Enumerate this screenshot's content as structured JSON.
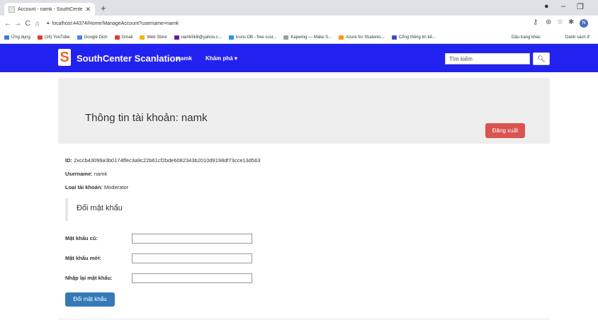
{
  "browser": {
    "tab_title": "Account - namk - SouthCenter S",
    "new_tab": "+",
    "address": "localhost:44374/Home/ManageAccount?username=namk",
    "profile_initial": "N",
    "bookmarks": [
      {
        "label": "Ứng dụng",
        "color": "#3c7ae5"
      },
      {
        "label": "(18) YouTube",
        "color": "#e53935"
      },
      {
        "label": "Google Dịch",
        "color": "#4285f4"
      },
      {
        "label": "Gmail",
        "color": "#e53935"
      },
      {
        "label": "Web Store",
        "color": "#f4b400"
      },
      {
        "label": "namk5kill@yahoo.c...",
        "color": "#6a1b9a"
      },
      {
        "label": "Icons DB - free cust...",
        "color": "#2196f3"
      },
      {
        "label": "Kapwing — Make S...",
        "color": "#9e9e9e"
      },
      {
        "label": "Azure for Students...",
        "color": "#ff9800"
      },
      {
        "label": "Cổng thông tin tiế...",
        "color": "#3f51b5"
      }
    ],
    "bookmarks_other": "Dấu trang khác",
    "reading_list": "Danh sách đ"
  },
  "site": {
    "brand": "SouthCenter Scanlation",
    "logo_letter": "S",
    "nav_user": "namk",
    "nav_explore": "Khám phá ▾",
    "search_placeholder": "Tìm kiếm"
  },
  "account": {
    "heading": "Thông tin tài khoản: namk",
    "logout_label": "Đăng xuất",
    "id_label": "ID:",
    "id_value": "2xccb43099a3b0174ffec3a9c22b61cf2bde6082343b2010d9198df73cce13d563",
    "username_label": "Username:",
    "username_value": "namk",
    "type_label": "Loại tài khoản:",
    "type_value": "Moderator"
  },
  "password_form": {
    "section_title": "Đổi mật khẩu",
    "old_label": "Mật khẩu cũ:",
    "new_label": "Mật khẩu mới:",
    "confirm_label": "Nhập lại mật khẩu:",
    "submit_label": "Đổi mật khẩu"
  },
  "colors": {
    "navbar": "#2222f0",
    "logout": "#d9534f",
    "submit": "#337ab7"
  }
}
